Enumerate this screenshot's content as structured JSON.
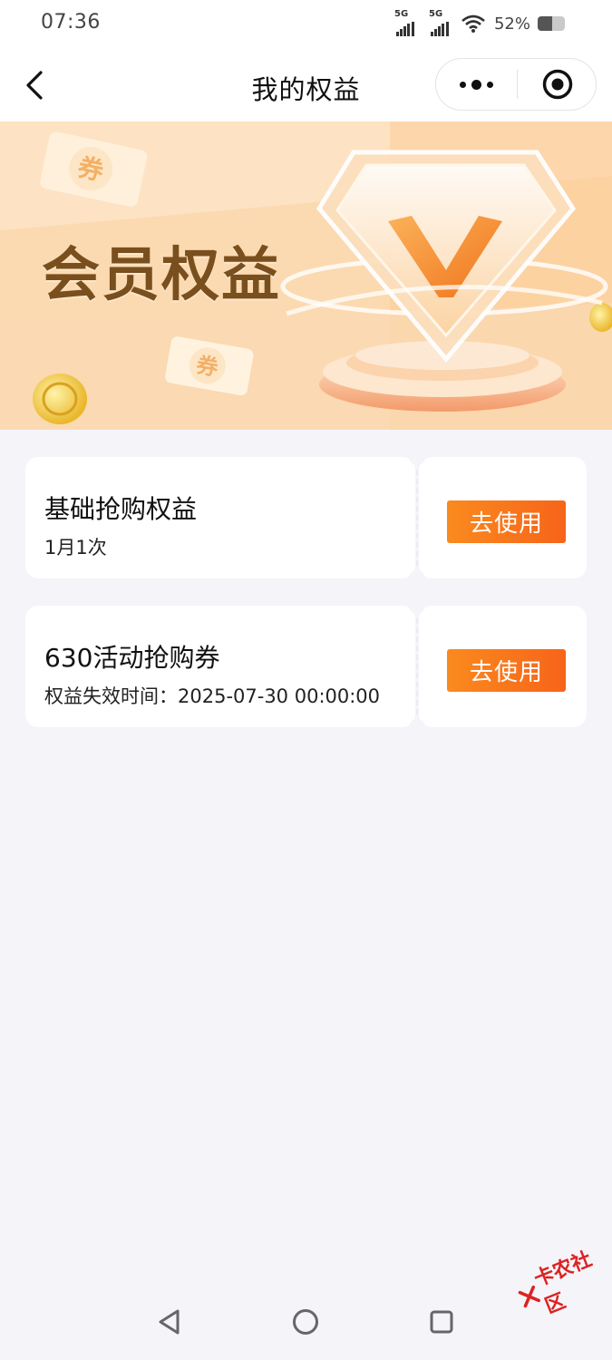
{
  "status_bar": {
    "time": "07:36",
    "signal_1_label": "5G",
    "signal_2_label": "5G",
    "wifi_icon": "wifi-icon",
    "battery_percent": "52%",
    "battery_level": 0.52
  },
  "nav": {
    "back_icon": "chevron-left-icon",
    "title": "我的权益",
    "more_icon": "more-dots-icon",
    "close_icon": "target-icon"
  },
  "banner": {
    "title": "会员权益",
    "coupon_text": "券",
    "colors": {
      "background_top": "#fde7c9",
      "background_bottom": "#fad3a2",
      "title": "#7a4f1e",
      "accent": "#f7641a"
    }
  },
  "benefits": [
    {
      "title": "基础抢购权益",
      "subtitle": "1月1次",
      "button_label": "去使用"
    },
    {
      "title": "630活动抢购券",
      "subtitle": "权益失效时间：2025-07-30 00:00:00",
      "button_label": "去使用"
    }
  ],
  "system_nav": {
    "back_icon": "triangle-back-icon",
    "home_icon": "circle-home-icon",
    "recents_icon": "square-recents-icon"
  },
  "watermark": {
    "text": "卡农社区"
  }
}
